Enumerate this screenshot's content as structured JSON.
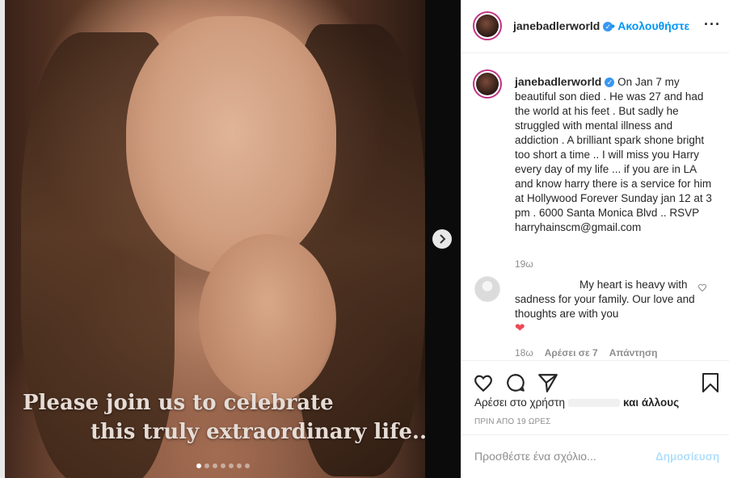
{
  "post": {
    "image_caption_line1": "Please join us to celebrate",
    "image_caption_line2": "this truly extraordinary life...",
    "carousel_dot_count": 7,
    "carousel_active_index": 0
  },
  "header": {
    "username": "janebadlerworld",
    "separator": "•",
    "follow_label": "Ακολουθήστε",
    "more_label": "···"
  },
  "caption": {
    "username": "janebadlerworld",
    "text": "On Jan 7 my beautiful son died . He was 27 and had the world at his feet . But sadly he struggled with mental illness and addiction . A brilliant spark shone bright too short a time .. I will miss you Harry every day of my life ... if you are in LA and know harry there is a service for him at Hollywood Forever Sunday jan 12 at 3 pm . 6000 Santa Monica Blvd .. RSVP harryhainscm@gmail.com",
    "time": "19ω"
  },
  "comment": {
    "username": "",
    "text": "My heart is heavy with sadness for your family. Our love and thoughts are with you",
    "emoji": "❤",
    "time": "18ω",
    "likes_label": "Αρέσει σε 7",
    "reply_label": "Απάντηση"
  },
  "likes": {
    "prefix": "Αρέσει στο χρήστη",
    "suffix": "και άλλους"
  },
  "timestamp": "ΠΡΙΝ ΑΠΟ 19 ΩΡΕΣ",
  "add_comment": {
    "placeholder": "Προσθέστε ένα σχόλιο...",
    "post_label": "Δημοσίευση"
  },
  "colors": {
    "accent": "#0095f6",
    "verified": "#3897f0",
    "heart": "#ed4956",
    "post_disabled": "#b2dffc"
  },
  "icons": {
    "like": "heart-outline-icon",
    "comment": "speech-bubble-icon",
    "share": "paper-plane-icon",
    "save": "bookmark-icon",
    "next": "chevron-right-icon",
    "verified": "verified-badge-icon"
  }
}
